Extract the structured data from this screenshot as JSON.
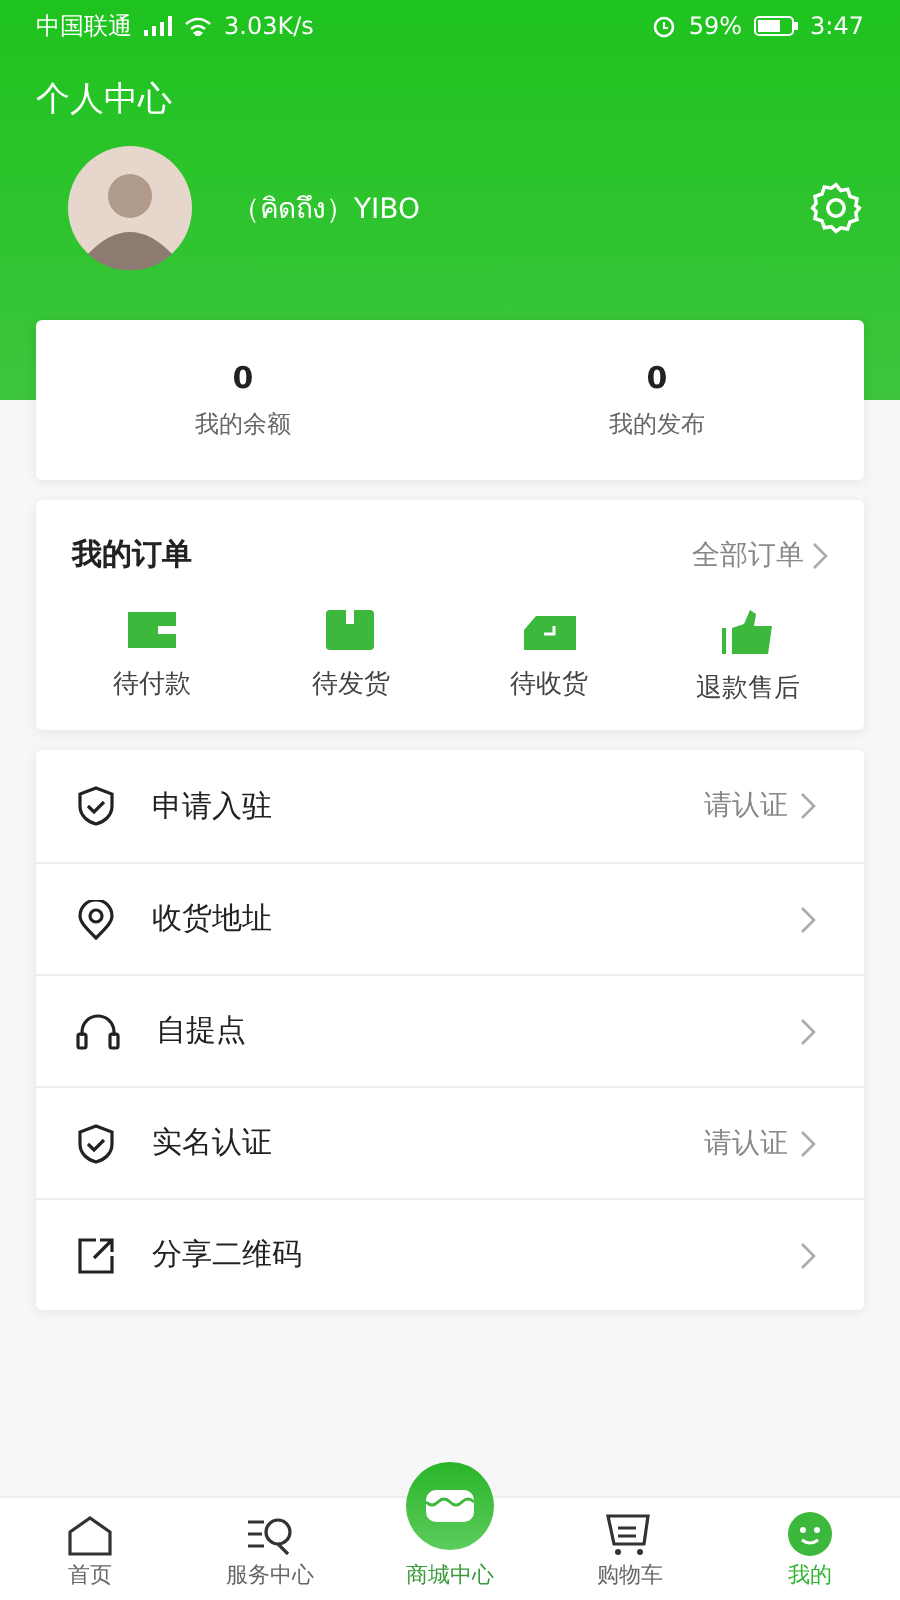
{
  "status_bar": {
    "carrier": "中国联通",
    "speed": "3.03K/s",
    "battery": "59%",
    "time": "3:47"
  },
  "header": {
    "title": "个人中心",
    "user_name": "（คิดถึง）YIBO"
  },
  "stats": [
    {
      "value": "0",
      "label": "我的余额"
    },
    {
      "value": "0",
      "label": "我的发布"
    }
  ],
  "orders": {
    "title": "我的订单",
    "all_link": "全部订单",
    "items": [
      {
        "kind": "wallet",
        "label": "待付款"
      },
      {
        "kind": "box",
        "label": "待发货"
      },
      {
        "kind": "truck",
        "label": "待收货"
      },
      {
        "kind": "thumb",
        "label": "退款售后"
      }
    ]
  },
  "menu": [
    {
      "kind": "shield",
      "label": "申请入驻",
      "status": "请认证"
    },
    {
      "kind": "pin",
      "label": "收货地址"
    },
    {
      "kind": "headset",
      "label": "自提点"
    },
    {
      "kind": "shield",
      "label": "实名认证",
      "status": "请认证"
    },
    {
      "kind": "share",
      "label": "分享二维码"
    }
  ],
  "nav": [
    {
      "kind": "home",
      "label": "首页",
      "selected": false
    },
    {
      "kind": "search",
      "label": "服务中心",
      "selected": false
    },
    {
      "kind": "shop",
      "label": "商城中心",
      "selected": false
    },
    {
      "kind": "cart",
      "label": "购物车",
      "selected": false
    },
    {
      "kind": "smile",
      "label": "我的",
      "selected": true
    }
  ]
}
